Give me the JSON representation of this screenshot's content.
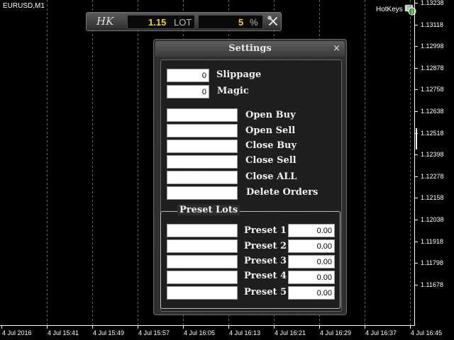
{
  "chart": {
    "symbol": "EURUSD,M1",
    "hotkeys_label": "HotKeys",
    "price_labels": [
      "1.13238",
      "1.13118",
      "1.12998",
      "1.12878",
      "1.12758",
      "1.12638",
      "1.12518",
      "1.12398",
      "1.12278",
      "1.12158",
      "1.12038",
      "1.11918",
      "1.11798",
      "1.11678"
    ],
    "time_labels": [
      "4 Jul 2016",
      "4 Jul 15:41",
      "4 Jul 15:49",
      "4 Jul 15:57",
      "4 Jul 16:05",
      "4 Jul 16:13",
      "4 Jul 16:21",
      "4 Jul 16:29",
      "4 Jul 16:37",
      "4 Jul 16:45"
    ]
  },
  "hk_bar": {
    "logo": "HK",
    "lot_value": "1.15",
    "lot_unit": "LOT",
    "percent_value": "5",
    "percent_unit": "%",
    "tool_icon": "wrench-icon"
  },
  "settings": {
    "title": "Settings",
    "close_glyph": "×",
    "slippage": {
      "value": "0",
      "label": "Slippage"
    },
    "magic": {
      "value": "0",
      "label": "Magic"
    },
    "hotkeys": [
      {
        "label": "Open Buy",
        "value": ""
      },
      {
        "label": "Open Sell",
        "value": ""
      },
      {
        "label": "Close Buy",
        "value": ""
      },
      {
        "label": "Close Sell",
        "value": ""
      },
      {
        "label": "Close ALL",
        "value": ""
      },
      {
        "label": "Delete Orders",
        "value": ""
      }
    ],
    "preset_group_title": "Preset Lots",
    "presets": [
      {
        "label": "Preset 1",
        "key": "",
        "lot": "0.00"
      },
      {
        "label": "Preset 2",
        "key": "",
        "lot": "0.00"
      },
      {
        "label": "Preset 3",
        "key": "",
        "lot": "0.00"
      },
      {
        "label": "Preset 4",
        "key": "",
        "lot": "0.00"
      },
      {
        "label": "Preset 5",
        "key": "",
        "lot": "0.00"
      }
    ]
  }
}
